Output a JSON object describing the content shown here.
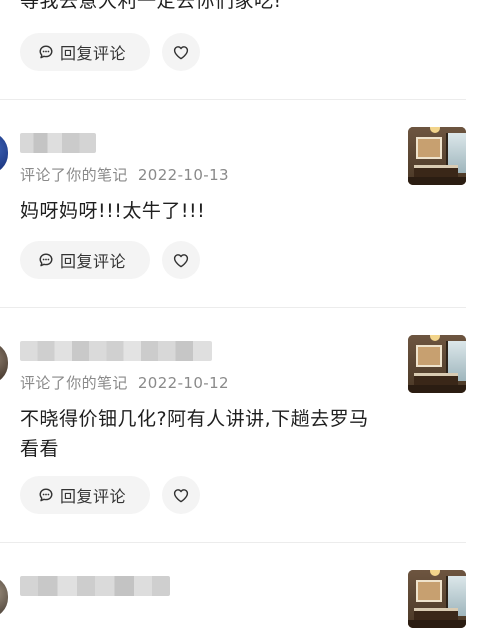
{
  "top_fragment": {
    "text": "等我去意大利一定去你们家吃!"
  },
  "actions": {
    "reply_label": "回复评论"
  },
  "comments": [
    {
      "meta_action": "评论了你的笔记",
      "date": "2022-10-13",
      "text": "妈呀妈呀!!!太牛了!!!"
    },
    {
      "meta_action": "评论了你的笔记",
      "date": "2022-10-12",
      "text": "不晓得价钿几化?阿有人讲讲,下趟去罗马看看"
    },
    {
      "meta_action": "",
      "date": "",
      "text": ""
    }
  ],
  "icons": {
    "reply": "comment-bubble-icon",
    "like": "heart-icon"
  },
  "colors": {
    "button_bg": "#f4f4f4",
    "meta_text": "#8a8a8a",
    "avatar_blue": "#2a4a9e"
  }
}
